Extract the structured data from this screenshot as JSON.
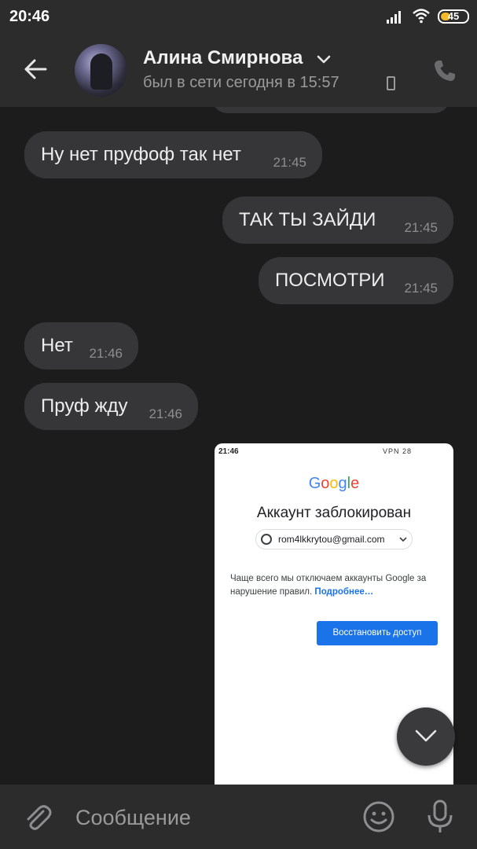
{
  "status_bar": {
    "time": "20:46",
    "battery_level": "45",
    "battery_fraction": 0.45,
    "icons": [
      "signal-icon",
      "wifi-icon",
      "battery-icon"
    ]
  },
  "header": {
    "contact_name": "Алина Смирнова",
    "last_seen": "был в сети сегодня в 15:57",
    "icons": [
      "back-arrow-icon",
      "chevron-down-icon",
      "phone-device-icon",
      "call-icon"
    ]
  },
  "messages": [
    {
      "side": "in",
      "text": "Ну нет пруфоф так нет",
      "time": "21:45"
    },
    {
      "side": "out",
      "text": "ТАК ТЫ ЗАЙДИ",
      "time": "21:45"
    },
    {
      "side": "out",
      "text": "ПОСМОТРИ",
      "time": "21:45"
    },
    {
      "side": "in",
      "text": "Нет",
      "time": "21:46"
    },
    {
      "side": "in",
      "text": "Пруф жду",
      "time": "21:46"
    }
  ],
  "image_message": {
    "screenshot_time": "21:46",
    "screenshot_status": "VPN 28",
    "google_word": "Google",
    "title": "Аккаунт заблокирован",
    "email": "rom4lkkrytou@gmail.com",
    "body": "Чаще всего мы отключаем аккаунты Google за нарушение правил.",
    "link": "Подробнее…",
    "button": "Восстановить доступ"
  },
  "composer": {
    "placeholder": "Сообщение",
    "icons": [
      "attach-icon",
      "emoji-icon",
      "microphone-icon"
    ]
  },
  "colors": {
    "background": "#1c1c1d",
    "bar": "#2c2c2d",
    "bubble": "#363638",
    "battery_accent": "#f3b92d",
    "google_blue": "#1a73e8"
  }
}
